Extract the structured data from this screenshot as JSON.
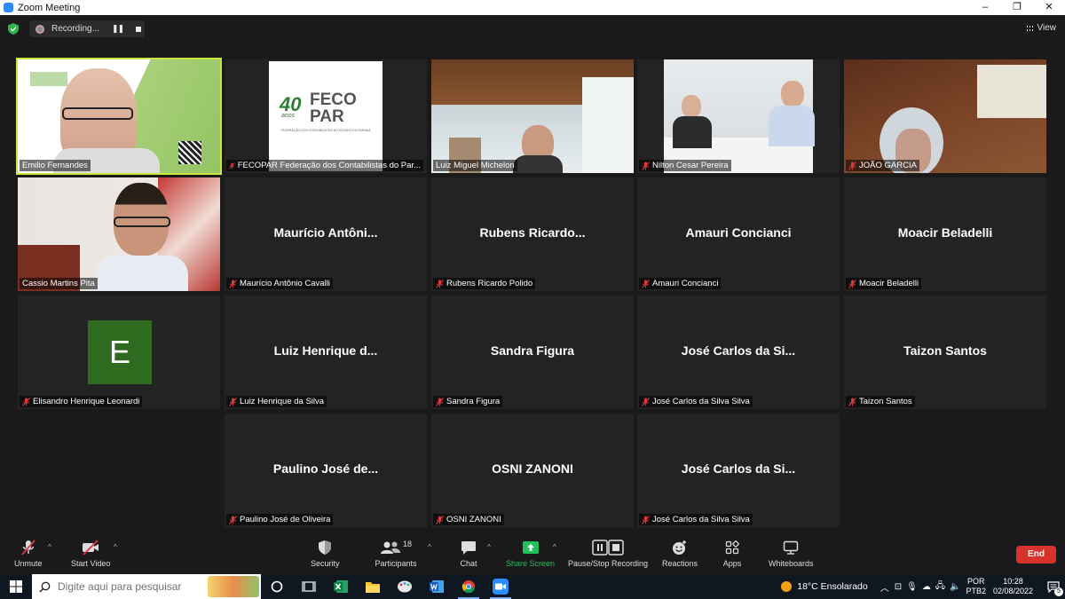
{
  "window": {
    "title": "Zoom Meeting",
    "minimize": "–",
    "maximize": "❐",
    "close": "✕"
  },
  "top": {
    "recording_label": "Recording...",
    "view_label": "View"
  },
  "tiles": [
    {
      "name": "Emilio Fernandes",
      "muted": false,
      "type": "video-emilio",
      "active": true
    },
    {
      "name": "FECOPAR Federação dos Contabilistas do Par...",
      "muted": true,
      "type": "video-logo"
    },
    {
      "name": "Luiz Miguel Michelon",
      "muted": false,
      "type": "video-luiz"
    },
    {
      "name": "Nilton Cesar Pereira",
      "muted": true,
      "type": "video-nilton"
    },
    {
      "name": "JOÃO GARCIA",
      "muted": true,
      "type": "video-joao"
    },
    {
      "name": "Cassio Martins Pita",
      "muted": false,
      "type": "video-cassio"
    },
    {
      "name": "Maurício Antônio Cavalli",
      "display": "Maurício  Antôni...",
      "muted": true,
      "type": "name"
    },
    {
      "name": "Rubens Ricardo Polido",
      "display": "Rubens  Ricardo...",
      "muted": true,
      "type": "name"
    },
    {
      "name": "Amauri Concianci",
      "display": "Amauri Concianci",
      "muted": true,
      "type": "name"
    },
    {
      "name": "Moacir Beladelli",
      "display": "Moacir Beladelli",
      "muted": true,
      "type": "name"
    },
    {
      "name": "Elisandro Henrique Leonardi",
      "initial": "E",
      "muted": true,
      "type": "avatar"
    },
    {
      "name": "Luiz Henrique da Silva",
      "display": "Luiz Henrique d...",
      "muted": true,
      "type": "name"
    },
    {
      "name": "Sandra Figura",
      "display": "Sandra Figura",
      "muted": true,
      "type": "name"
    },
    {
      "name": "José Carlos da Silva Silva",
      "display": "José Carlos da Si...",
      "muted": true,
      "type": "name"
    },
    {
      "name": "Taizon Santos",
      "display": "Taizon Santos",
      "muted": true,
      "type": "name"
    },
    {
      "name": "Paulino José de Oliveira",
      "display": "Paulino José de...",
      "muted": true,
      "type": "name"
    },
    {
      "name": "OSNI ZANONI",
      "display": "OSNI ZANONI",
      "muted": true,
      "type": "name"
    },
    {
      "name": "José Carlos da Silva Silva",
      "display": "José Carlos da Si...",
      "muted": true,
      "type": "name"
    }
  ],
  "logo": {
    "number": "40",
    "anos": "anos",
    "line1": "FECO",
    "line2": "PAR",
    "subtitle": "FEDERAÇÃO DOS CONTABILISTAS DO ESTADO DO PARANÁ"
  },
  "toolbar": {
    "unmute": "Unmute",
    "start_video": "Start Video",
    "security": "Security",
    "participants": "Participants",
    "participants_count": "18",
    "chat": "Chat",
    "share_screen": "Share Screen",
    "pause_stop": "Pause/Stop Recording",
    "reactions": "Reactions",
    "apps": "Apps",
    "whiteboards": "Whiteboards",
    "end": "End"
  },
  "taskbar": {
    "search_placeholder": "Digite aqui para pesquisar",
    "weather": "18°C  Ensolarado",
    "lang1": "POR",
    "lang2": "PTB2",
    "time": "10:28",
    "date": "02/08/2022",
    "notif_count": "5"
  },
  "colors": {
    "active_border": "#c8e63c",
    "share_green": "#21c05a",
    "end_red": "#d8322d",
    "mute_red": "#e0393e"
  }
}
